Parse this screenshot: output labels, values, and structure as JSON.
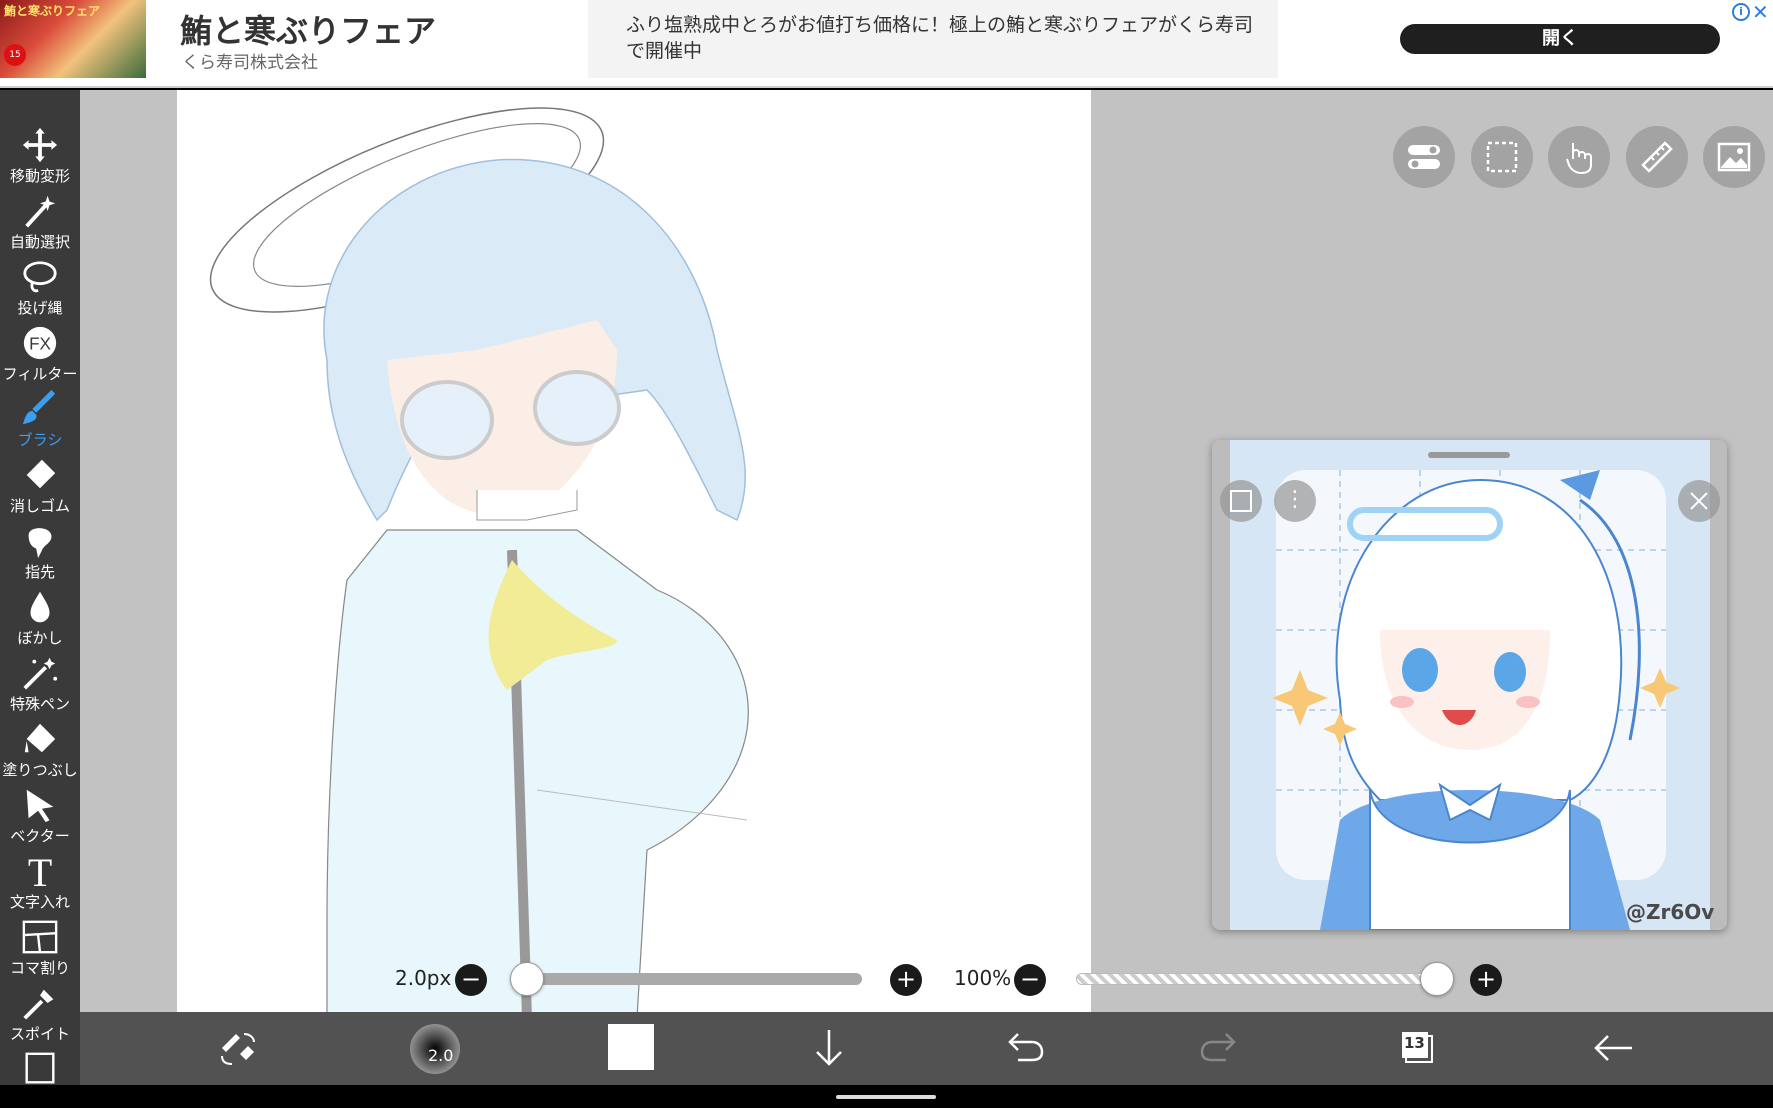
{
  "ad": {
    "badge": "15",
    "thumb_title": "鮪と寒ぶりフェア",
    "title": "鮪と寒ぶりフェア",
    "advertiser": "くら寿司株式会社",
    "description": "ふり塩熟成中とろがお値打ち価格に！極上の鮪と寒ぶりフェアがくら寿司で開催中",
    "open_label": "開く",
    "info_label": "i",
    "close_label": "✕"
  },
  "toolbar": {
    "tools": [
      {
        "label": "移動変形",
        "icon": "move-icon"
      },
      {
        "label": "自動選択",
        "icon": "magic-wand-icon"
      },
      {
        "label": "投げ縄",
        "icon": "lasso-icon"
      },
      {
        "label": "フィルター",
        "icon": "fx-icon",
        "glyph": "FX"
      },
      {
        "label": "ブラシ",
        "icon": "brush-icon",
        "active": true
      },
      {
        "label": "消しゴム",
        "icon": "eraser-icon"
      },
      {
        "label": "指先",
        "icon": "finger-icon"
      },
      {
        "label": "ぼかし",
        "icon": "blur-drop-icon"
      },
      {
        "label": "特殊ペン",
        "icon": "special-pen-icon"
      },
      {
        "label": "塗りつぶし",
        "icon": "fill-bucket-icon"
      },
      {
        "label": "ベクター",
        "icon": "vector-arrow-icon"
      },
      {
        "label": "文字入れ",
        "icon": "text-icon",
        "glyph": "T"
      },
      {
        "label": "コマ割り",
        "icon": "panel-icon"
      },
      {
        "label": "スポイト",
        "icon": "eyedropper-icon"
      }
    ]
  },
  "top_buttons": [
    "toggle-icon",
    "selection-icon",
    "hand-icon",
    "ruler-icon",
    "image-icon"
  ],
  "reference": {
    "watermark": "@Zr6Ov",
    "menu_glyph": "⋮"
  },
  "brush": {
    "size_label": "2.0px",
    "size_fraction": 0.0,
    "minus": "−",
    "plus": "+"
  },
  "opacity": {
    "label": "100%",
    "fraction": 1.0,
    "minus": "−",
    "plus": "+"
  },
  "bottombar": {
    "brush_preview_size": "2.0",
    "layer_count": "13"
  },
  "colors": {
    "active_tool": "#3a9ef2",
    "toolbar_bg": "#3a3a3a",
    "workspace_bg": "#c2c2c2",
    "bottombar_bg": "#525252",
    "current_color": "#ffffff"
  }
}
